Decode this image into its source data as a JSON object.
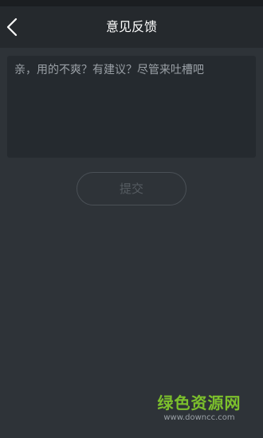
{
  "header": {
    "title": "意见反馈",
    "back_icon": "chevron-left-icon"
  },
  "feedback": {
    "placeholder": "亲，用的不爽？有建议？尽管来吐槽吧",
    "value": ""
  },
  "submit": {
    "label": "提交"
  },
  "watermark": {
    "main": "绿色资源网",
    "url": "www.downcc.com"
  },
  "colors": {
    "background": "#2e3338",
    "header": "#25292d",
    "input_background": "#252a2f",
    "watermark_green": "#7cc02c"
  }
}
